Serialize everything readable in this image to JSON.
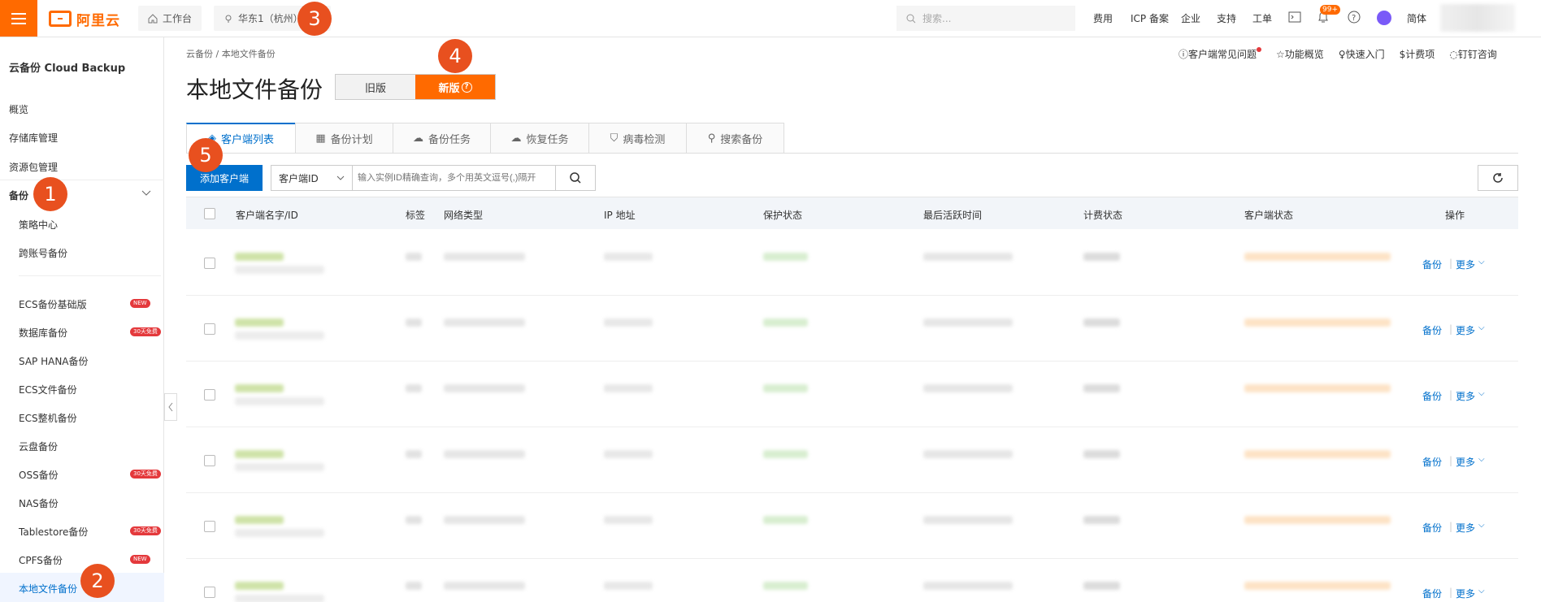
{
  "topbar": {
    "menu_icon": "menu-icon",
    "logo": "阿里云",
    "workbench": "工作台",
    "region": "华东1（杭州）",
    "search_placeholder": "搜索...",
    "nav": [
      "费用",
      "ICP 备案",
      "企业",
      "支持",
      "工单"
    ],
    "badge": "99+",
    "lang": "简体"
  },
  "sidebar": {
    "title": "云备份 Cloud Backup",
    "items": [
      "概览",
      "存储库管理",
      "资源包管理"
    ],
    "backup_group": "备份",
    "sub1": [
      "策略中心",
      "跨账号备份"
    ],
    "sub2": [
      {
        "label": "ECS备份基础版",
        "tag": "NEW"
      },
      {
        "label": "数据库备份",
        "tag": "30天免费"
      },
      {
        "label": "SAP HANA备份",
        "tag": ""
      },
      {
        "label": "ECS文件备份",
        "tag": ""
      },
      {
        "label": "ECS整机备份",
        "tag": ""
      },
      {
        "label": "云盘备份",
        "tag": ""
      },
      {
        "label": "OSS备份",
        "tag": "30天免费"
      },
      {
        "label": "NAS备份",
        "tag": ""
      },
      {
        "label": "Tablestore备份",
        "tag": "30天免费"
      },
      {
        "label": "CPFS备份",
        "tag": "NEW"
      },
      {
        "label": "本地文件备份",
        "tag": ""
      }
    ]
  },
  "main": {
    "breadcrumb": "云备份 / 本地文件备份",
    "title": "本地文件备份",
    "old": "旧版",
    "new": "新版",
    "links": [
      "客户端常见问题",
      "功能概览",
      "快速入门",
      "计费项",
      "钉钉咨询"
    ],
    "tabs": [
      "客户端列表",
      "备份计划",
      "备份任务",
      "恢复任务",
      "病毒检测",
      "搜索备份"
    ],
    "add": "添加客户端",
    "select": "客户端ID",
    "input_placeholder": "输入实例ID精确查询，多个用英文逗号(,)隔开",
    "columns": [
      "客户端名字/ID",
      "标签",
      "网络类型",
      "IP 地址",
      "保护状态",
      "最后活跃时间",
      "计费状态",
      "客户端状态",
      "操作"
    ],
    "row_actions": {
      "backup": "备份",
      "more": "更多"
    }
  },
  "annotations": [
    "1",
    "2",
    "3",
    "4",
    "5"
  ],
  "colors": {
    "accent": "#ff6a00",
    "link": "#0070cc",
    "callout": "#e8501f"
  }
}
